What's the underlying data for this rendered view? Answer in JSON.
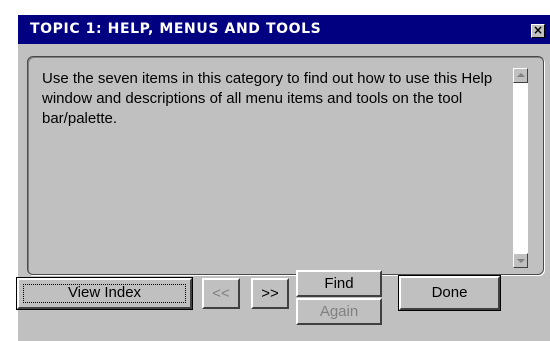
{
  "window": {
    "title": "TOPIC 1: HELP, MENUS AND TOOLS",
    "close_glyph": "×"
  },
  "content": {
    "text": "Use the seven items in this category to find out how to use this Help window and descriptions of all menu items and tools on the tool bar/palette."
  },
  "buttons": {
    "view_index": "View Index",
    "prev": "<<",
    "next": ">>",
    "find": "Find",
    "again": "Again",
    "done": "Done"
  },
  "icons": {
    "close": "close-icon",
    "scroll_up": "scroll-up-arrow-icon",
    "scroll_down": "scroll-down-arrow-icon"
  },
  "colors": {
    "titlebar": "#000080",
    "title_text": "#ffffff",
    "window_bg": "#c0c0c0",
    "disabled_text": "#808080"
  }
}
